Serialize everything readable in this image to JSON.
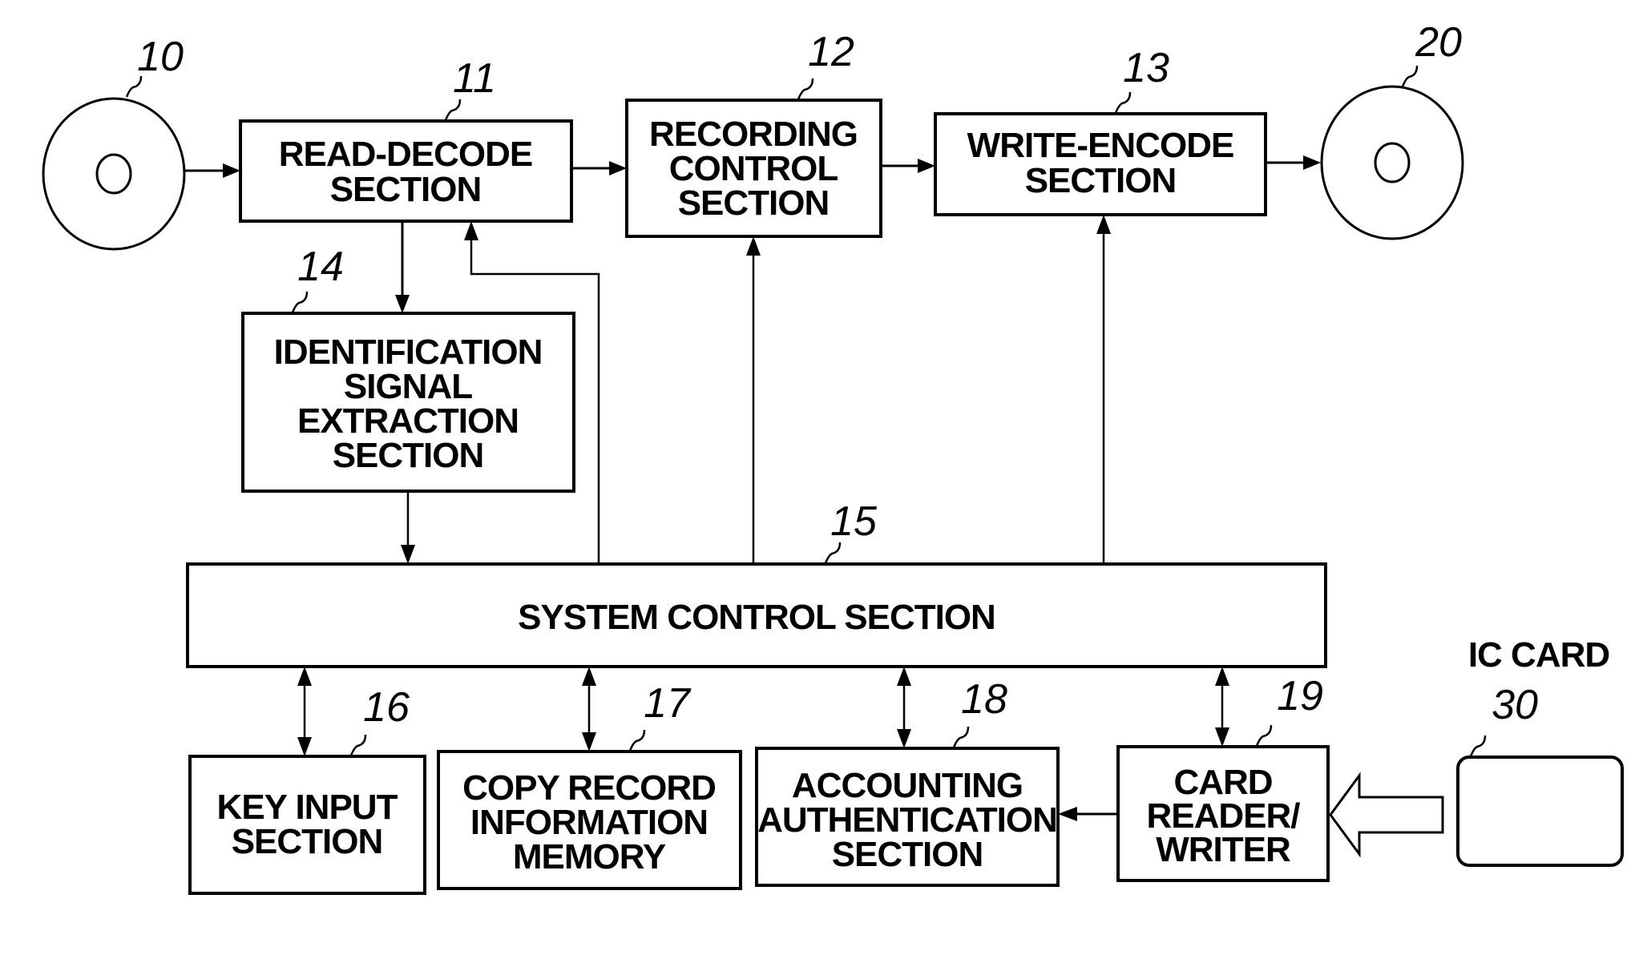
{
  "figure": {
    "blocks": {
      "disc_source": {
        "ref": "10"
      },
      "read_decode": {
        "ref": "11",
        "lines": [
          "READ-DECODE",
          "SECTION"
        ]
      },
      "recording_control": {
        "ref": "12",
        "lines": [
          "RECORDING",
          "CONTROL",
          "SECTION"
        ]
      },
      "write_encode": {
        "ref": "13",
        "lines": [
          "WRITE-ENCODE",
          "SECTION"
        ]
      },
      "disc_target": {
        "ref": "20"
      },
      "id_signal_extraction": {
        "ref": "14",
        "lines": [
          "IDENTIFICATION",
          "SIGNAL",
          "EXTRACTION",
          "SECTION"
        ]
      },
      "system_control": {
        "ref": "15",
        "lines": [
          "SYSTEM CONTROL SECTION"
        ]
      },
      "key_input": {
        "ref": "16",
        "lines": [
          "KEY INPUT",
          "SECTION"
        ]
      },
      "copy_record_memory": {
        "ref": "17",
        "lines": [
          "COPY RECORD",
          "INFORMATION",
          "MEMORY"
        ]
      },
      "accounting_auth": {
        "ref": "18",
        "lines": [
          "ACCOUNTING",
          "AUTHENTICATION",
          "SECTION"
        ]
      },
      "card_reader_writer": {
        "ref": "19",
        "lines": [
          "CARD",
          "READER/",
          "WRITER"
        ]
      },
      "ic_card": {
        "ref": "30",
        "caption": "IC CARD"
      }
    }
  }
}
